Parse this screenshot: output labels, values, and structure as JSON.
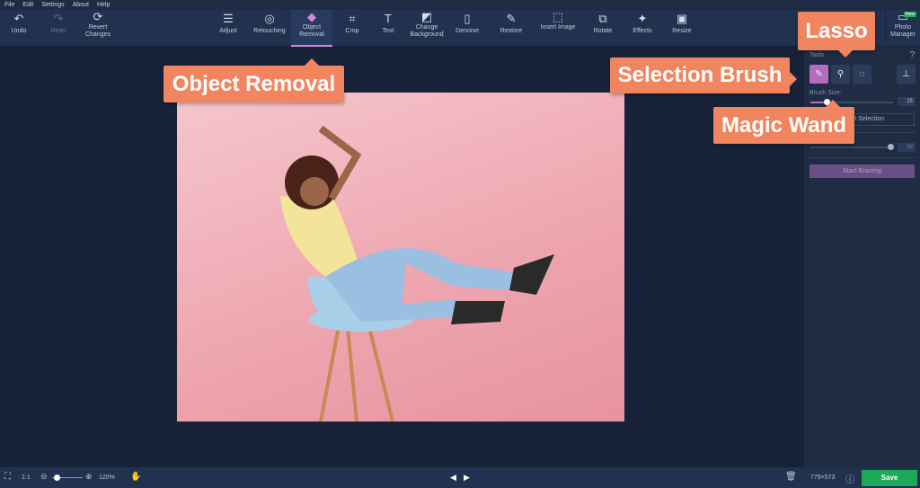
{
  "menu": [
    "File",
    "Edit",
    "Settings",
    "About",
    "Help"
  ],
  "toolbar": {
    "undo": "Undo",
    "redo": "Redo",
    "revert": "Revert Changes",
    "tools": [
      {
        "label": "Adjust",
        "icon": "☰"
      },
      {
        "label": "Retouching",
        "icon": "◎"
      },
      {
        "label": "Object Removal",
        "icon": "◆"
      },
      {
        "label": "Crop",
        "icon": "⌗"
      },
      {
        "label": "Text",
        "icon": "T"
      },
      {
        "label": "Change Background",
        "icon": "◩"
      },
      {
        "label": "Denoise",
        "icon": "▯"
      },
      {
        "label": "Restore",
        "icon": "✎"
      },
      {
        "label": "Insert Image",
        "icon": "⬚"
      },
      {
        "label": "Rotate",
        "icon": "⧉"
      },
      {
        "label": "Effects",
        "icon": "✦"
      },
      {
        "label": "Resize",
        "icon": "▣"
      }
    ],
    "photo_manager": "Photo Manager",
    "new_badge": "New"
  },
  "panel": {
    "tools_label": "Tools",
    "help": "?",
    "brush_size_label": "Brush Size:",
    "brush_size": 25,
    "brush_size_fraction": 0.2,
    "reset_selection": "Reset Selection",
    "second_value": 99,
    "second_fraction": 0.97,
    "start_erasing": "Start Erasing"
  },
  "bottom": {
    "ratio": "1:1",
    "zoom": "120%",
    "zoom_fraction": 0.15,
    "dimensions": "779×573",
    "save": "Save"
  },
  "callouts": {
    "object_removal": "Object Removal",
    "lasso": "Lasso",
    "selection_brush": "Selection Brush",
    "magic_wand": "Magic Wand"
  },
  "colors": {
    "accent": "#b36cc0",
    "callout": "#f0855f",
    "save": "#1da95a"
  }
}
